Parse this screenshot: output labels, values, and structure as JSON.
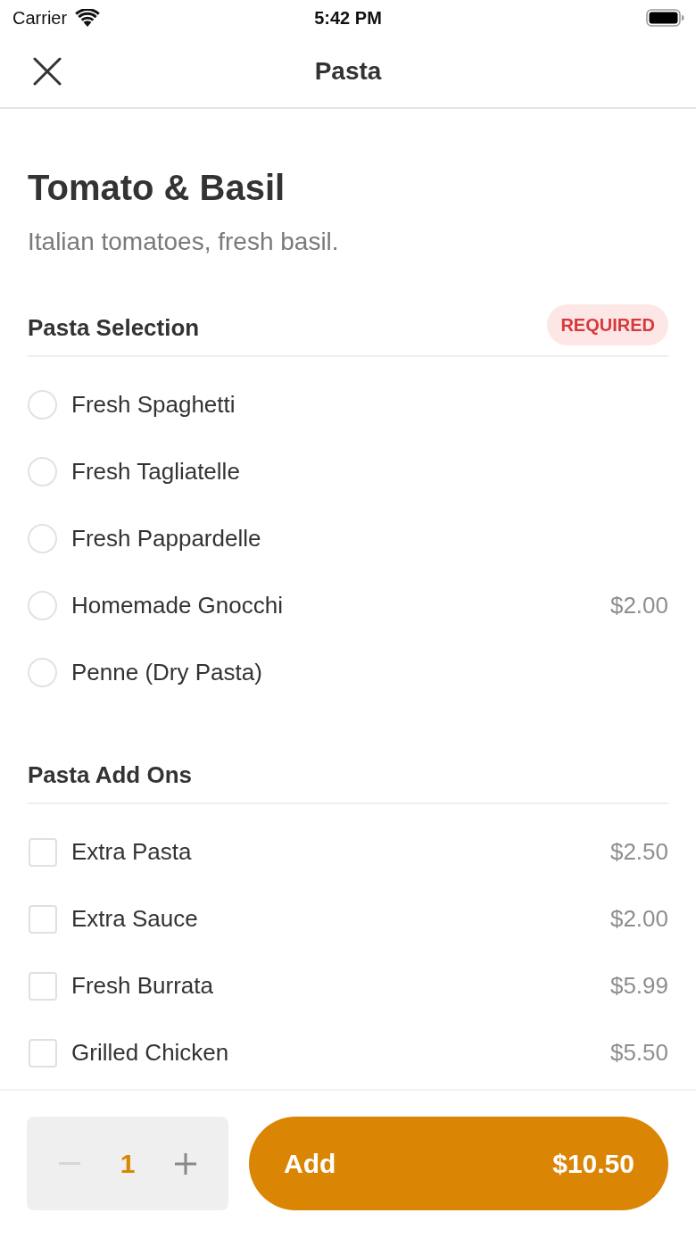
{
  "status_bar": {
    "carrier": "Carrier",
    "time": "5:42 PM"
  },
  "nav": {
    "title": "Pasta"
  },
  "item": {
    "name": "Tomato & Basil",
    "description": "Italian tomatoes, fresh basil."
  },
  "sections": [
    {
      "title": "Pasta Selection",
      "badge": "REQUIRED",
      "kind": "radio",
      "options": [
        {
          "label": "Fresh Spaghetti",
          "selected": false
        },
        {
          "label": "Fresh Tagliatelle",
          "selected": false
        },
        {
          "label": "Fresh Pappardelle",
          "selected": false
        },
        {
          "label": "Homemade Gnocchi",
          "price": "$2.00",
          "selected": false
        },
        {
          "label": "Penne (Dry Pasta)",
          "selected": false
        }
      ]
    },
    {
      "title": "Pasta Add Ons",
      "kind": "checkbox",
      "options": [
        {
          "label": "Extra Pasta",
          "price": "$2.50",
          "checked": false
        },
        {
          "label": "Extra Sauce",
          "price": "$2.00",
          "checked": false
        },
        {
          "label": "Fresh Burrata",
          "price": "$5.99",
          "checked": false
        },
        {
          "label": "Grilled Chicken",
          "price": "$5.50",
          "checked": false
        }
      ]
    }
  ],
  "footer": {
    "quantity": "1",
    "decrement_disabled": true,
    "add_label": "Add",
    "total": "$10.50"
  }
}
